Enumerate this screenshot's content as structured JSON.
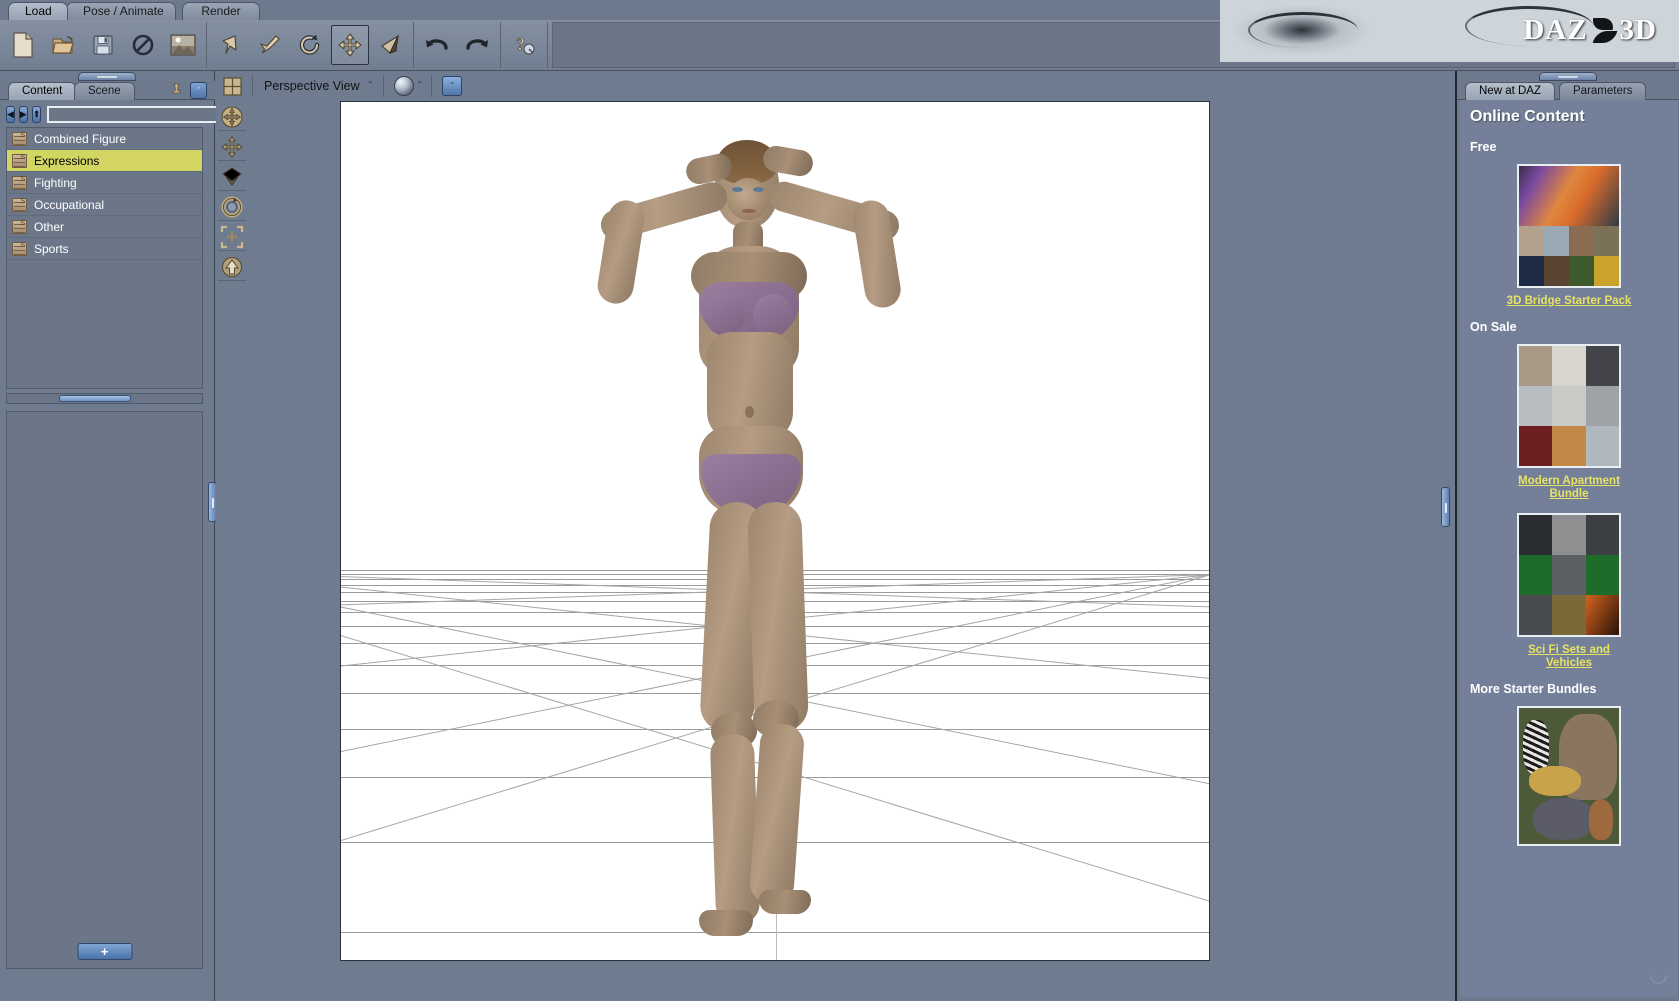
{
  "app": {
    "title": "DAZ Studio",
    "logo_text": "DAZ",
    "logo_suffix": "3D"
  },
  "main_tabs": [
    {
      "label": "Load",
      "active": true
    },
    {
      "label": "Pose / Animate",
      "active": false
    },
    {
      "label": "Render",
      "active": false
    }
  ],
  "toolbar": {
    "groups": [
      {
        "buttons": [
          {
            "icon": "new-document-icon",
            "label": "New"
          },
          {
            "icon": "open-folder-icon",
            "label": "Open"
          },
          {
            "icon": "save-floppy-icon",
            "label": "Save"
          },
          {
            "icon": "no-entry-icon",
            "label": "Clear"
          },
          {
            "icon": "image-thumbnail-icon",
            "label": "Image"
          }
        ]
      },
      {
        "buttons": [
          {
            "icon": "arrow-select-icon",
            "label": "Select"
          },
          {
            "icon": "bone-node-icon",
            "label": "Node"
          },
          {
            "icon": "rotate-tool-icon",
            "label": "Rotate"
          },
          {
            "icon": "translate-move-icon",
            "label": "Translate",
            "selected": true
          },
          {
            "icon": "spotlight-cone-icon",
            "label": "Spotlight"
          }
        ]
      },
      {
        "buttons": [
          {
            "icon": "undo-arrow-icon",
            "label": "Undo"
          },
          {
            "icon": "redo-arrow-icon",
            "label": "Redo"
          }
        ]
      },
      {
        "buttons": [
          {
            "icon": "help-question-icon",
            "label": "Help"
          }
        ]
      }
    ]
  },
  "left_panel": {
    "tabs": [
      {
        "label": "Content",
        "active": true
      },
      {
        "label": "Scene",
        "active": false
      }
    ],
    "nav": {
      "back_label": "◀",
      "forward_label": "▶",
      "up_label": "⬆",
      "path_value": "",
      "path_placeholder": "",
      "dropdown_label": "▼",
      "search_icon": "magnifier-icon"
    },
    "items": [
      {
        "label": "Combined Figure",
        "selected": false
      },
      {
        "label": "Expressions",
        "selected": true
      },
      {
        "label": "Fighting",
        "selected": false
      },
      {
        "label": "Occupational",
        "selected": false
      },
      {
        "label": "Other",
        "selected": false
      },
      {
        "label": "Sports",
        "selected": false
      }
    ],
    "add_button_label": "+"
  },
  "viewport": {
    "layout_icon": "viewport-layout-icon",
    "camera_label": "Perspective View",
    "camera_chevron": "ˇ",
    "draw_style_icon": "shading-sphere-icon",
    "draw_style_chevron": "ˇ",
    "collapse_label": "ˇ",
    "tools": [
      {
        "icon": "orbit-camera-icon",
        "label": "Orbit"
      },
      {
        "icon": "pan-camera-icon",
        "label": "Pan"
      },
      {
        "icon": "dolly-camera-icon",
        "label": "Dolly"
      },
      {
        "icon": "rotate-camera-icon",
        "label": "Rotate"
      },
      {
        "icon": "frame-selection-icon",
        "label": "Frame"
      },
      {
        "icon": "reset-camera-icon",
        "label": "Reset"
      }
    ],
    "scene": {
      "figure_label": "female-figure-3d-model",
      "pose": "arms-behind-head",
      "background_color": "#ffffff",
      "grid_color": "#9a9a9a"
    }
  },
  "right_panel": {
    "tabs": [
      {
        "label": "New at DAZ",
        "active": true
      },
      {
        "label": "Parameters",
        "active": false
      }
    ],
    "title": "Online Content",
    "sections": [
      {
        "heading": "Free",
        "items": [
          {
            "link": "3D Bridge Starter Pack",
            "thumb": "bridge-starter-pack-thumb"
          }
        ]
      },
      {
        "heading": "On Sale",
        "items": [
          {
            "link": "Modern Apartment Bundle",
            "thumb": "modern-apartment-thumb"
          },
          {
            "link": "Sci Fi Sets and Vehicles",
            "thumb": "scifi-sets-thumb"
          }
        ]
      },
      {
        "heading": "More Starter Bundles",
        "items": [
          {
            "link": "",
            "thumb": "animals-bundle-thumb"
          }
        ]
      }
    ]
  },
  "colors": {
    "panel_bg": "#6f7b8e",
    "selection": "#d2d562",
    "link": "#e8e263",
    "canvas": "#ffffff",
    "accent_blue": "#5076a9"
  }
}
